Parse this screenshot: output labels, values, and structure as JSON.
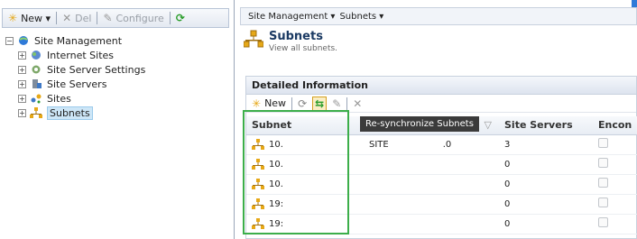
{
  "left_toolbar": {
    "new_label": "New ▾",
    "delete_label": "Del",
    "configure_label": "Configure"
  },
  "tree": {
    "root_label": "Site Management",
    "items": [
      {
        "label": "Internet Sites",
        "icon": "globe-icon"
      },
      {
        "label": "Site Server Settings",
        "icon": "gear-server-icon"
      },
      {
        "label": "Site Servers",
        "icon": "server-icon"
      },
      {
        "label": "Sites",
        "icon": "sites-icon"
      },
      {
        "label": "Subnets",
        "icon": "network-icon",
        "selected": true
      }
    ]
  },
  "breadcrumb": {
    "items": [
      "Site Management ▾",
      "Subnets ▾"
    ]
  },
  "header": {
    "title": "Subnets",
    "subtitle": "View all subnets."
  },
  "detail": {
    "title": "Detailed Information",
    "new_label": "New",
    "tooltip": "Re-synchronize Subnets",
    "columns": [
      "Subnet",
      "",
      "Site Servers",
      "Encon"
    ],
    "rows": [
      {
        "subnet": "10.",
        "site": "SITE",
        "version": ".0",
        "servers": "3"
      },
      {
        "subnet": "10.",
        "site": "",
        "version": "",
        "servers": "0"
      },
      {
        "subnet": "10.",
        "site": "",
        "version": "",
        "servers": "0"
      },
      {
        "subnet": "19:",
        "site": "",
        "version": "",
        "servers": "0"
      },
      {
        "subnet": "19:",
        "site": "",
        "version": "",
        "servers": "0"
      }
    ]
  },
  "colors": {
    "highlight_box": "#3cae4a",
    "tooltip_bg": "#3b3b3b",
    "selection_bg": "#cde6f7"
  }
}
